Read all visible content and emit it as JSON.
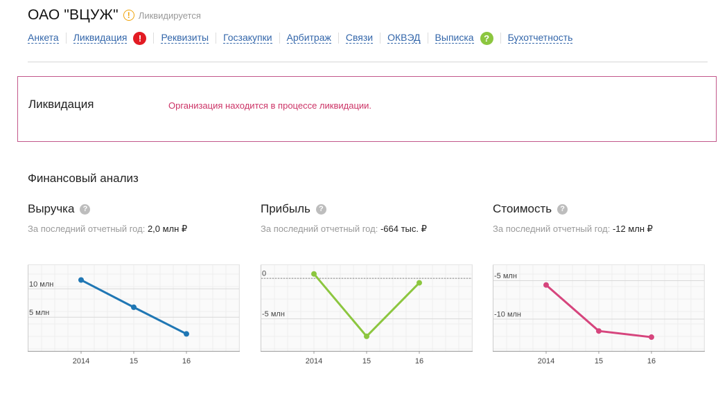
{
  "company": {
    "name": "ОАО \"ВЦУЖ\"",
    "status": "Ликвидируется",
    "status_icon": "warning-icon"
  },
  "nav": [
    {
      "label": "Анкета"
    },
    {
      "label": "Ликвидация",
      "badge": "!",
      "badge_color": "#e21b23"
    },
    {
      "label": "Реквизиты"
    },
    {
      "label": "Госзакупки"
    },
    {
      "label": "Арбитраж"
    },
    {
      "label": "Связи"
    },
    {
      "label": "ОКВЭД"
    },
    {
      "label": "Выписка",
      "badge": "?",
      "badge_color": "#8cc63f"
    },
    {
      "label": "Бухотчетность"
    }
  ],
  "liquidation": {
    "title": "Ликвидация",
    "message": "Организация находится в процессе ликвидации."
  },
  "finance": {
    "title": "Финансовый анализ",
    "last_year_label": "За последний отчетный год:",
    "blocks": [
      {
        "title": "Выручка",
        "value": "2,0 млн ₽"
      },
      {
        "title": "Прибыль",
        "value": "-664 тыс. ₽"
      },
      {
        "title": "Стоимость",
        "value": "-12 млн ₽"
      }
    ]
  },
  "chart_data": [
    {
      "type": "line",
      "x": [
        "2014",
        "15",
        "16"
      ],
      "series": [
        {
          "values": [
            11.5,
            6.7,
            2.0
          ]
        }
      ],
      "ylim": [
        -1,
        14
      ],
      "yticks": [
        {
          "value": 10,
          "label": "10 млн"
        },
        {
          "value": 5,
          "label": "5 млн"
        }
      ],
      "color": "#2077b4",
      "grid": true
    },
    {
      "type": "line",
      "x": [
        "2014",
        "15",
        "16"
      ],
      "series": [
        {
          "values": [
            0.5,
            -7.2,
            -0.6
          ]
        }
      ],
      "ylim": [
        -9,
        1.5
      ],
      "yticks": [
        {
          "value": 0,
          "label": "0"
        },
        {
          "value": -5,
          "label": "-5 млн"
        }
      ],
      "zero_line": true,
      "color": "#8cc63f",
      "grid": true
    },
    {
      "type": "line",
      "x": [
        "2014",
        "15",
        "16"
      ],
      "series": [
        {
          "values": [
            -5.6,
            -11.6,
            -12.4
          ]
        }
      ],
      "ylim": [
        -14.2,
        -3.1
      ],
      "yticks": [
        {
          "value": -5,
          "label": "-5 млн"
        },
        {
          "value": -10,
          "label": "-10 млн"
        }
      ],
      "color": "#d6457d",
      "grid": true
    }
  ]
}
